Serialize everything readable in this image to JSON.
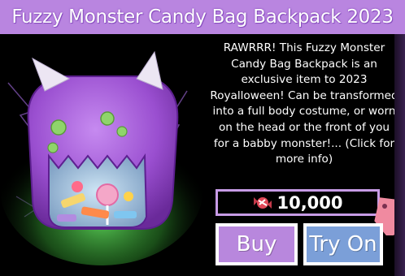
{
  "title": "Fuzzy Monster Candy Bag Backpack 2023",
  "description": "RAWRRR! This Fuzzy Monster Candy Bag Backpack is an exclusive item to 2023 Royalloween! Can be transformed into a full body costume, or worn on the head or the front of you for a babby monster!... (Click for more info)",
  "price": "10,000",
  "buttons": {
    "buy": "Buy",
    "try_on": "Try On"
  },
  "colors": {
    "title_bar": "#b985e0",
    "price_border": "#c79be6",
    "buy_button": "#b887dd",
    "try_on_button": "#7b9fd8",
    "monster_purple": "#a45ad8",
    "glow_green": "#5dd45a"
  },
  "icons": {
    "currency": "candy-icon",
    "tag": "price-tag-icon"
  }
}
